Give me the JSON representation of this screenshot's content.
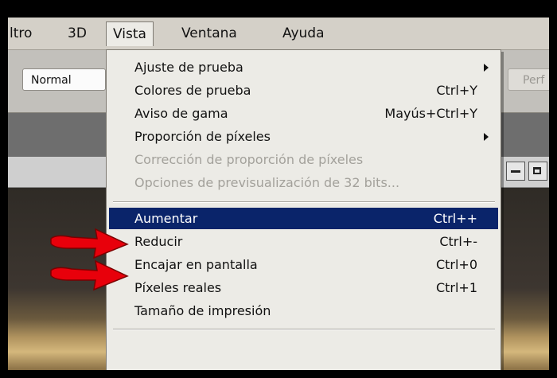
{
  "menubar": {
    "items": [
      {
        "label": "ltro"
      },
      {
        "label": "3D"
      },
      {
        "label": "Vista"
      },
      {
        "label": "Ventana"
      },
      {
        "label": "Ayuda"
      }
    ]
  },
  "options_bar": {
    "mode_value": "Normal",
    "perf_label": "Perf"
  },
  "vista_menu": {
    "items": [
      {
        "label": "Ajuste de prueba",
        "shortcut": "",
        "submenu": true,
        "enabled": true
      },
      {
        "label": "Colores de prueba",
        "shortcut": "Ctrl+Y",
        "submenu": false,
        "enabled": true
      },
      {
        "label": "Aviso de gama",
        "shortcut": "Mayús+Ctrl+Y",
        "submenu": false,
        "enabled": true
      },
      {
        "label": "Proporción de píxeles",
        "shortcut": "",
        "submenu": true,
        "enabled": true
      },
      {
        "label": "Corrección de proporción de píxeles",
        "shortcut": "",
        "submenu": false,
        "enabled": false
      },
      {
        "label": "Opciones de previsualización de 32 bits...",
        "shortcut": "",
        "submenu": false,
        "enabled": false
      },
      {
        "label": "Aumentar",
        "shortcut": "Ctrl++",
        "submenu": false,
        "enabled": true,
        "highlighted": true
      },
      {
        "label": "Reducir",
        "shortcut": "Ctrl+-",
        "submenu": false,
        "enabled": true
      },
      {
        "label": "Encajar en pantalla",
        "shortcut": "Ctrl+0",
        "submenu": false,
        "enabled": true
      },
      {
        "label": "Píxeles reales",
        "shortcut": "Ctrl+1",
        "submenu": false,
        "enabled": true
      },
      {
        "label": "Tamaño de impresión",
        "shortcut": "",
        "submenu": false,
        "enabled": true
      }
    ]
  },
  "colors": {
    "highlight": "#0a246a",
    "menu_bg": "#ecebe6",
    "annotation_arrow": "#e8000b"
  }
}
